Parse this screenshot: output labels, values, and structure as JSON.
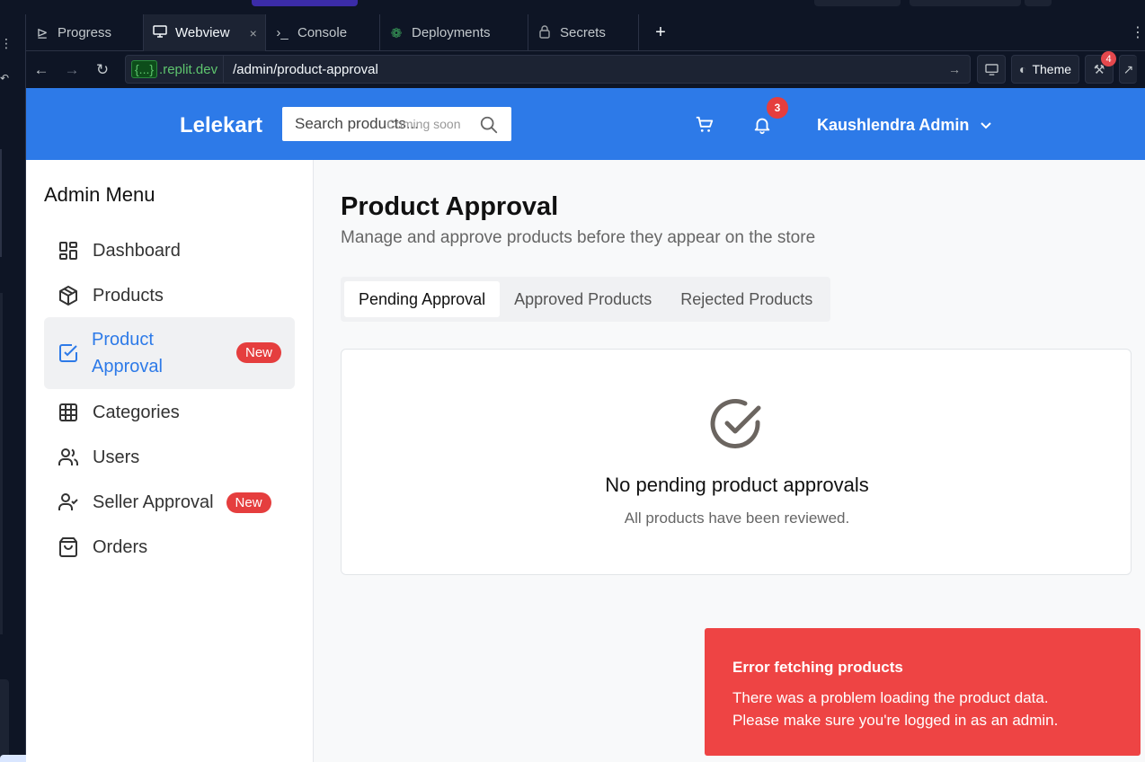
{
  "ide": {
    "tabs": [
      {
        "label": "Progress",
        "icon": "progress-icon"
      },
      {
        "label": "Webview",
        "icon": "monitor-icon",
        "active": true,
        "close": "×"
      },
      {
        "label": "Console",
        "icon": "terminal-icon"
      },
      {
        "label": "Deployments",
        "icon": "deploy-icon"
      },
      {
        "label": "Secrets",
        "icon": "lock-icon"
      }
    ],
    "add_tab": "+",
    "url": {
      "badge": "{...}",
      "domain": ".replit.dev",
      "path": "/admin/product-approval"
    },
    "theme_label": "Theme",
    "devtools_count": "4"
  },
  "header": {
    "logo": "Lelekart",
    "search_placeholder": "Search products...",
    "search_hint": "Coming soon",
    "notification_count": "3",
    "user_name": "Kaushlendra Admin",
    "brand_color": "#2d7ae8"
  },
  "sidebar": {
    "title": "Admin Menu",
    "items": [
      {
        "label": "Dashboard",
        "icon": "dashboard-icon"
      },
      {
        "label": "Products",
        "icon": "package-icon"
      },
      {
        "label": "Product Approval",
        "icon": "check-square-icon",
        "badge": "New",
        "active": true
      },
      {
        "label": "Categories",
        "icon": "grid-icon"
      },
      {
        "label": "Users",
        "icon": "users-icon"
      },
      {
        "label": "Seller Approval",
        "icon": "user-check-icon",
        "badge": "New"
      },
      {
        "label": "Orders",
        "icon": "shopping-bag-icon"
      }
    ]
  },
  "main": {
    "title": "Product Approval",
    "subtitle": "Manage and approve products before they appear on the store",
    "tabs": [
      "Pending Approval",
      "Approved Products",
      "Rejected Products"
    ],
    "selected_tab": "Pending Approval",
    "empty_title": "No pending product approvals",
    "empty_text": "All products have been reviewed."
  },
  "toast": {
    "title": "Error fetching products",
    "message": "There was a problem loading the product data. Please make sure you're logged in as an admin.",
    "color": "#ee4444"
  }
}
